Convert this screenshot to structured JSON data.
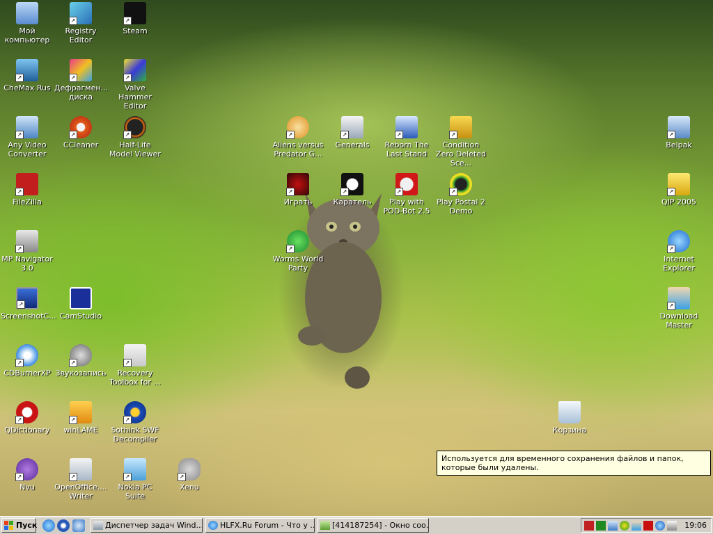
{
  "desktop_icons": {
    "my_computer": "Мой компьютер",
    "registry_editor": "Registry Editor",
    "steam": "Steam",
    "chemax": "CheMax Rus",
    "defrag": "Дефрагмен... диска",
    "valve_hammer": "Valve Hammer Editor",
    "any_video": "Any Video Converter",
    "ccleaner": "CCleaner",
    "hl_model_viewer": "Half-Life Model Viewer",
    "avp": "Aliens versus Predator G...",
    "generals": "Generals",
    "reborn": "Reborn The Last Stand",
    "cz_deleted": "Condition Zero Deleted Sce...",
    "belpak": "Belpak",
    "filezilla": "FileZilla",
    "igrat": "Играть",
    "karatel": "Каратель",
    "podbot": "Play with POD-Bot 2.5",
    "postal2": "Play Postal 2 Demo",
    "qip": "QIP 2005",
    "mp_navigator": "MP Navigator 3.0",
    "worms": "Worms World Party",
    "ie": "Internet Explorer",
    "screenshot": "ScreenshotC...",
    "camstudio": "CamStudio",
    "download_master": "Download Master",
    "cdburner": "CDBurnerXP",
    "zvukozapis": "Звукозапись",
    "recovery": "Recovery Toolbox for ...",
    "qdictionary": "QDictionary",
    "winlame": "winLAME",
    "sothink": "Sothink SWF Decompiler",
    "recycle_bin": "Корзина",
    "nvu": "Nvu",
    "openoffice": "OpenOffice.... Writer",
    "nokia": "Nokia PC Suite",
    "xenu": "Xenu"
  },
  "tooltip": {
    "text": "Используется для временного сохранения файлов и папок, которые были удалены."
  },
  "taskbar": {
    "start_label": "Пуск",
    "tasks": [
      "Диспетчер задач Wind...",
      "HLFX.Ru Forum - Что у ...",
      "[414187254] - Окно соо..."
    ],
    "clock": "19:06"
  }
}
